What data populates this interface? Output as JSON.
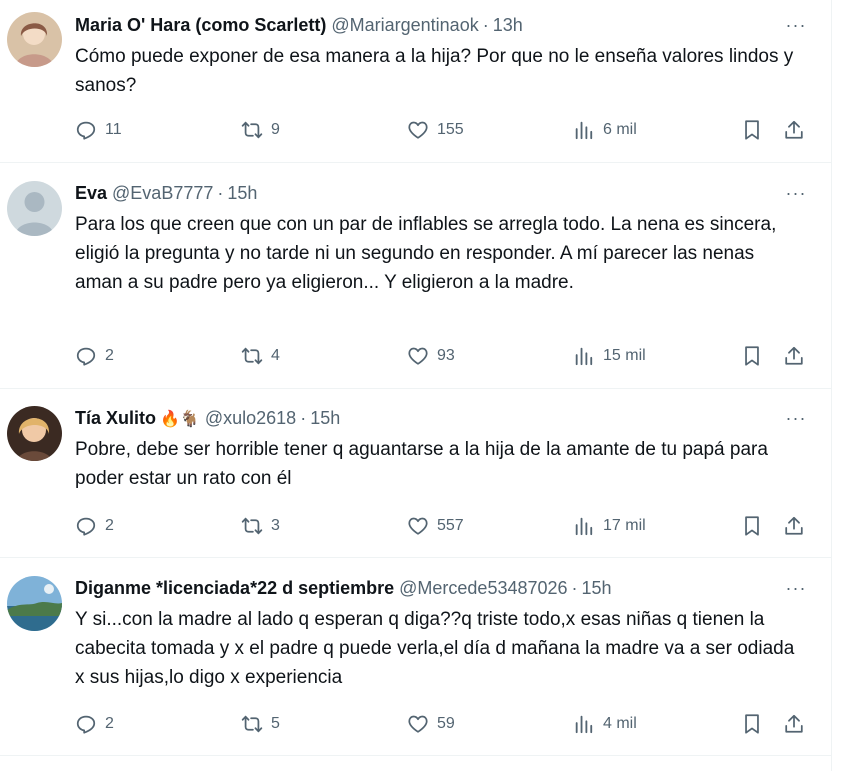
{
  "tweets": [
    {
      "name": "Maria O' Hara (como Scarlett)",
      "emoji": "",
      "handle": "@Mariargentinaok",
      "separator": "·",
      "time": "13h",
      "text": "Cómo puede exponer de esa manera a la hija? Por que no le enseña valores lindos y sanos?",
      "replies": "11",
      "reposts": "9",
      "likes": "155",
      "views": "6 mil",
      "more": "···"
    },
    {
      "name": "Eva",
      "emoji": "",
      "handle": "@EvaB7777",
      "separator": "·",
      "time": "15h",
      "text": "Para los que creen que con un par de inflables se arregla todo. La nena es sincera, eligió la pregunta y no tarde ni un segundo en responder. A mí parecer las nenas aman a su padre pero ya eligieron... Y eligieron a la madre.",
      "replies": "2",
      "reposts": "4",
      "likes": "93",
      "views": "15 mil",
      "more": "···"
    },
    {
      "name": "Tía Xulito",
      "emoji": "🔥🐐",
      "handle": "@xulo2618",
      "separator": "·",
      "time": "15h",
      "text": "Pobre, debe ser horrible tener q aguantarse a la hija de la amante de tu papá para poder estar un rato con él",
      "replies": "2",
      "reposts": "3",
      "likes": "557",
      "views": "17 mil",
      "more": "···"
    },
    {
      "name": "Diganme *licenciada*22 d septiembre",
      "emoji": "",
      "handle": "@Mercede53487026",
      "separator": "·",
      "time": "15h",
      "text": "Y si...con la madre al lado q esperan q diga??q triste todo,x esas niñas q tienen la cabecita tomada y x el padre q puede verla,el día d mañana la madre va a ser odiada x sus hijas,lo digo x experiencia",
      "replies": "2",
      "reposts": "5",
      "likes": "59",
      "views": "4 mil",
      "more": "···"
    }
  ],
  "icons": {
    "reply": "reply-icon",
    "repost": "repost-icon",
    "like": "heart-icon",
    "views": "analytics-icon",
    "bookmark": "bookmark-icon",
    "share": "share-icon",
    "more": "more-options-icon"
  },
  "colors": {
    "text": "#0f1419",
    "secondary": "#536471",
    "divider": "#eff3f4"
  }
}
